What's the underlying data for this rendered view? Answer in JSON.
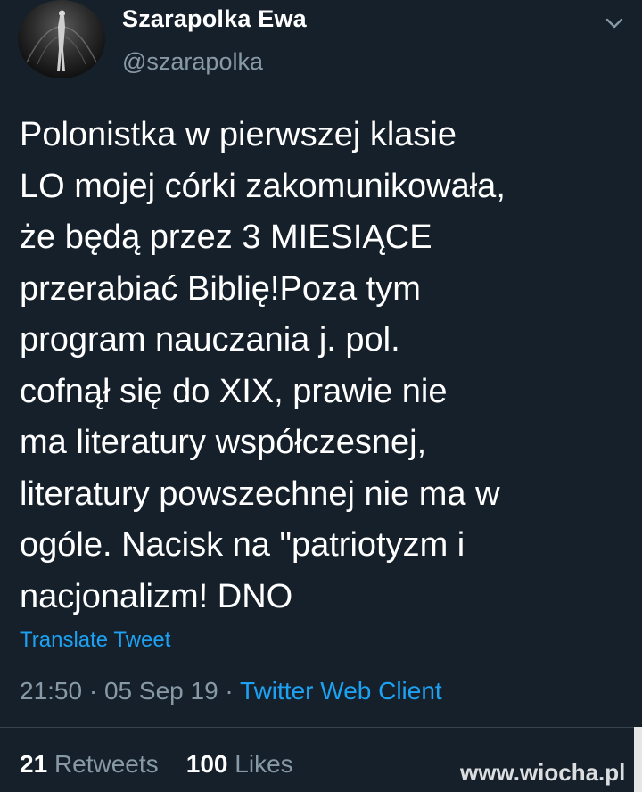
{
  "author": {
    "display_name": "Szarapolka Ewa",
    "username": "@szarapolka",
    "avatar_icon": "avatar-photo"
  },
  "tweet": {
    "lines": [
      "Polonistka w pierwszej klasie",
      "LO mojej córki zakomunikowała,",
      "że będą przez 3 MIESIĄCE",
      "przerabiać Biblię!Poza tym",
      "program nauczania j. pol.",
      "cofnął się do XIX, prawie nie",
      "ma literatury współczesnej,",
      "literatury powszechnej nie ma w",
      "ogóle. Nacisk na \"patriotyzm i",
      "nacjonalizm! DNO"
    ],
    "translate_label": "Translate Tweet"
  },
  "meta": {
    "time": "21:50",
    "separator": "·",
    "date": "05 Sep 19",
    "client": "Twitter Web Client"
  },
  "stats": {
    "retweets_count": "21",
    "retweets_label": "Retweets",
    "likes_count": "100",
    "likes_label": "Likes"
  },
  "watermark": "www.wiocha.pl",
  "colors": {
    "background": "#15202b",
    "text": "#ffffff",
    "secondary": "#8899a6",
    "accent": "#1da1f2",
    "divider": "#38444d"
  }
}
